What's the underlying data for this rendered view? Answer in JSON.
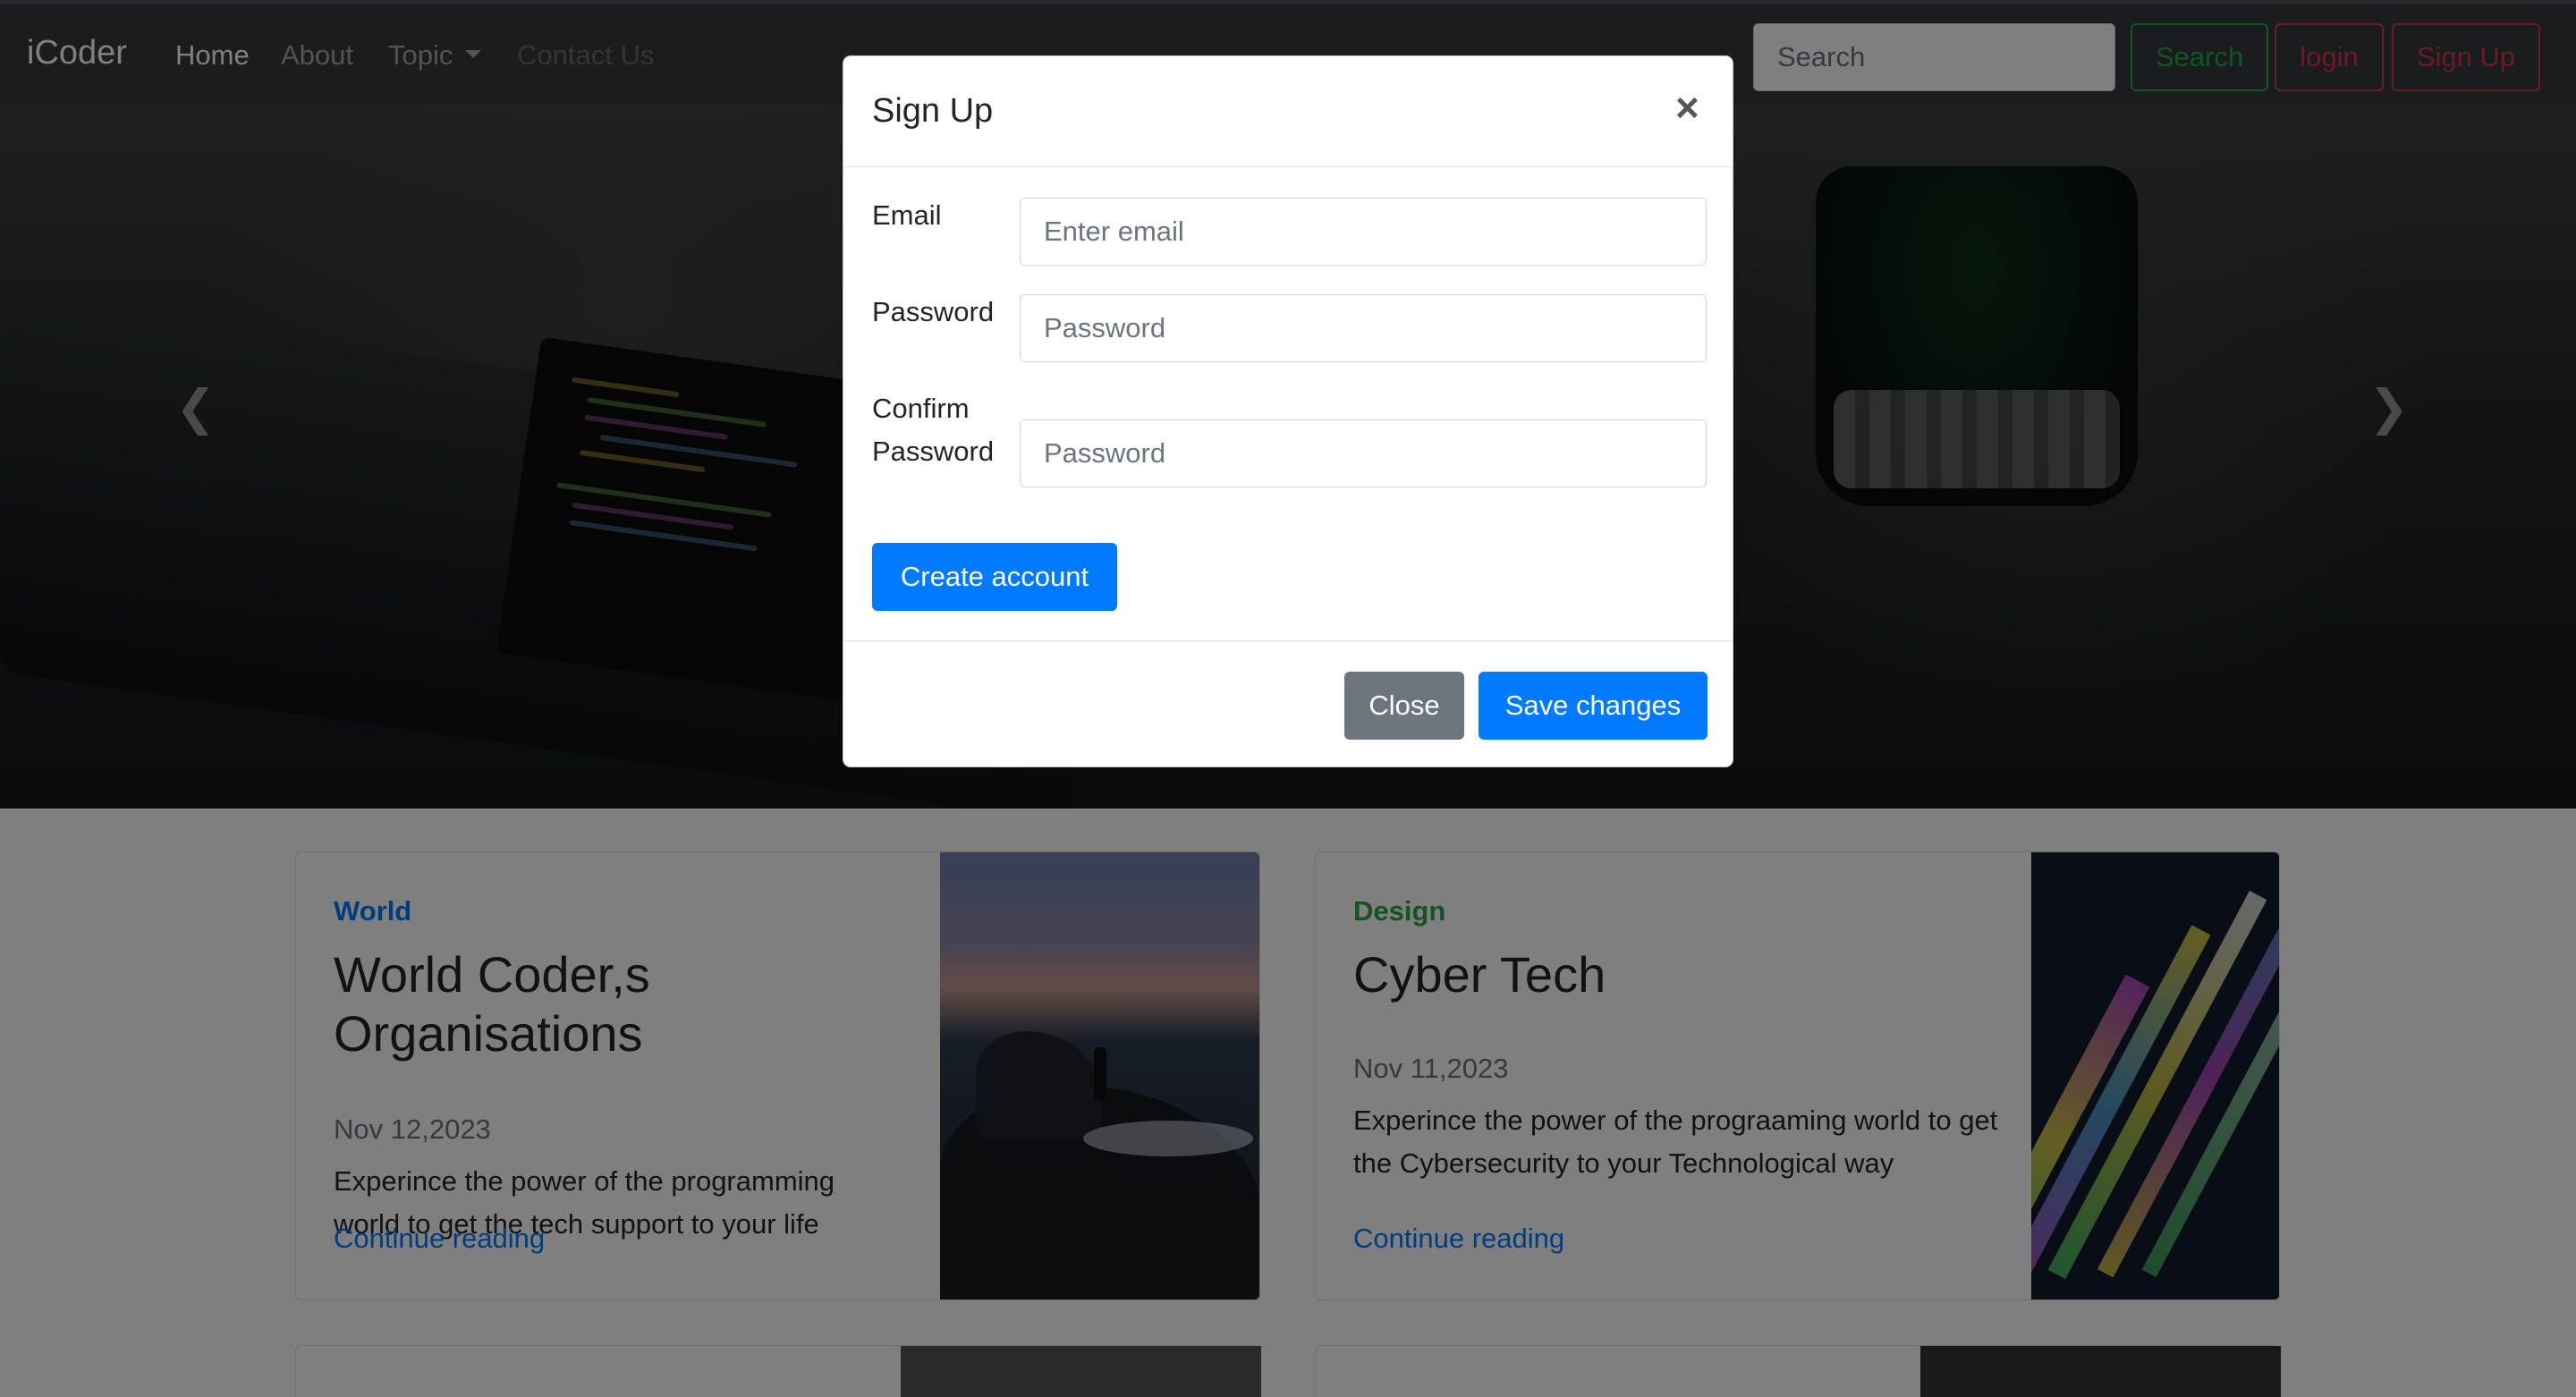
{
  "navbar": {
    "brand": "iCoder",
    "links": [
      {
        "label": "Home"
      },
      {
        "label": "About"
      },
      {
        "label": "Topic"
      },
      {
        "label": "Contact Us"
      }
    ],
    "search_placeholder": "Search",
    "search_button": "Search",
    "login_button": "login",
    "signup_button": "Sign Up"
  },
  "carousel": {
    "prev_icon": "chevron-left-icon",
    "next_icon": "chevron-right-icon"
  },
  "modal": {
    "title": "Sign Up",
    "close_glyph": "×",
    "email_label": "Email",
    "email_placeholder": "Enter email",
    "password_label": "Password",
    "password_placeholder": "Password",
    "confirm_label_line1": "Confirm",
    "confirm_label_line2": "Password",
    "confirm_placeholder": "Password",
    "create_button": "Create account",
    "close_button": "Close",
    "save_button": "Save changes"
  },
  "cards": [
    {
      "category": "World",
      "title": "World Coder,s Organisations",
      "date": "Nov 12,2023",
      "description": "Experince the power of the programming world to get the tech support to your life",
      "link": "Continue reading"
    },
    {
      "category": "Design",
      "title": "Cyber Tech",
      "date": "Nov 11,2023",
      "description": "Experince the power of the prograaming world to get the Cybersecurity to your Technological way",
      "link": "Continue reading"
    }
  ],
  "colors": {
    "navbar_bg": "#343a40",
    "primary": "#007bff",
    "success": "#28a745",
    "danger": "#dc3545",
    "secondary": "#6c757d"
  }
}
